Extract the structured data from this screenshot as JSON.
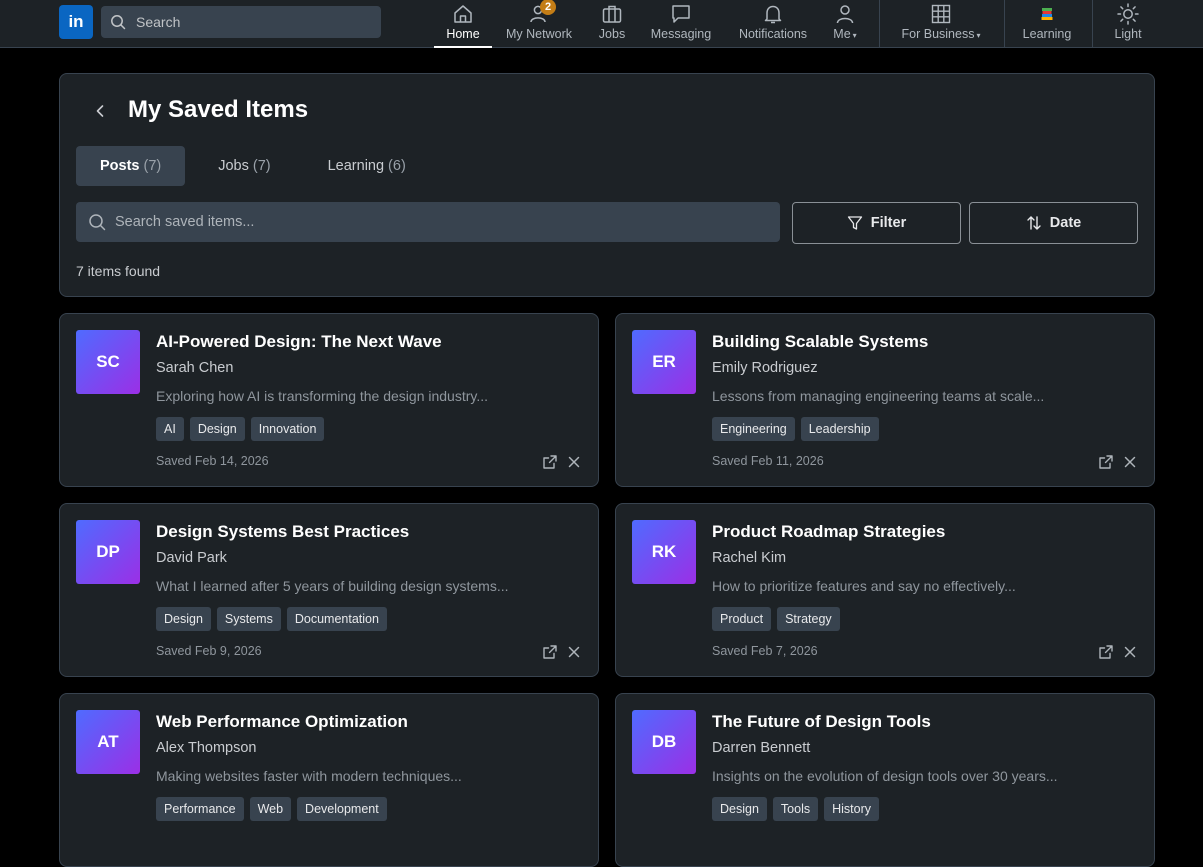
{
  "nav": {
    "logo": "in",
    "search_placeholder": "Search",
    "items": [
      {
        "label": "Home",
        "icon": "home-icon",
        "active": true
      },
      {
        "label": "My Network",
        "icon": "network-icon",
        "badge": "2"
      },
      {
        "label": "Jobs",
        "icon": "briefcase-icon"
      },
      {
        "label": "Messaging",
        "icon": "message-icon"
      },
      {
        "label": "Notifications",
        "icon": "bell-icon"
      },
      {
        "label": "Me",
        "icon": "user-icon",
        "caret": "▾"
      },
      {
        "label": "For Business",
        "icon": "grid-icon",
        "caret": "▾"
      },
      {
        "label": "Learning",
        "icon": "books-icon"
      },
      {
        "label": "Light",
        "icon": "sun-icon"
      }
    ]
  },
  "header": {
    "title": "My Saved Items",
    "tabs": [
      {
        "label": "Posts",
        "count": "(7)",
        "active": true
      },
      {
        "label": "Jobs",
        "count": "(7)"
      },
      {
        "label": "Learning",
        "count": "(6)"
      }
    ],
    "search_placeholder": "Search saved items...",
    "filter_label": "Filter",
    "sort_label": "Date",
    "results": "7 items found"
  },
  "items": [
    {
      "initials": "SC",
      "title": "AI-Powered Design: The Next Wave",
      "author": "Sarah Chen",
      "excerpt": "Exploring how AI is transforming the design industry...",
      "tags": [
        "AI",
        "Design",
        "Innovation"
      ],
      "saved": "Saved Feb 14, 2026"
    },
    {
      "initials": "ER",
      "title": "Building Scalable Systems",
      "author": "Emily Rodriguez",
      "excerpt": "Lessons from managing engineering teams at scale...",
      "tags": [
        "Engineering",
        "Leadership"
      ],
      "saved": "Saved Feb 11, 2026"
    },
    {
      "initials": "DP",
      "title": "Design Systems Best Practices",
      "author": "David Park",
      "excerpt": "What I learned after 5 years of building design systems...",
      "tags": [
        "Design",
        "Systems",
        "Documentation"
      ],
      "saved": "Saved Feb 9, 2026"
    },
    {
      "initials": "RK",
      "title": "Product Roadmap Strategies",
      "author": "Rachel Kim",
      "excerpt": "How to prioritize features and say no effectively...",
      "tags": [
        "Product",
        "Strategy"
      ],
      "saved": "Saved Feb 7, 2026"
    },
    {
      "initials": "AT",
      "title": "Web Performance Optimization",
      "author": "Alex Thompson",
      "excerpt": "Making websites faster with modern techniques...",
      "tags": [
        "Performance",
        "Web",
        "Development"
      ],
      "saved": ""
    },
    {
      "initials": "DB",
      "title": "The Future of Design Tools",
      "author": "Darren Bennett",
      "excerpt": "Insights on the evolution of design tools over 30 years...",
      "tags": [
        "Design",
        "Tools",
        "History"
      ],
      "saved": ""
    }
  ],
  "colors": {
    "accent": "#0a66c2",
    "badge": "#c37d16",
    "background": "#000000",
    "card": "#1d2226",
    "border": "#38434f"
  }
}
